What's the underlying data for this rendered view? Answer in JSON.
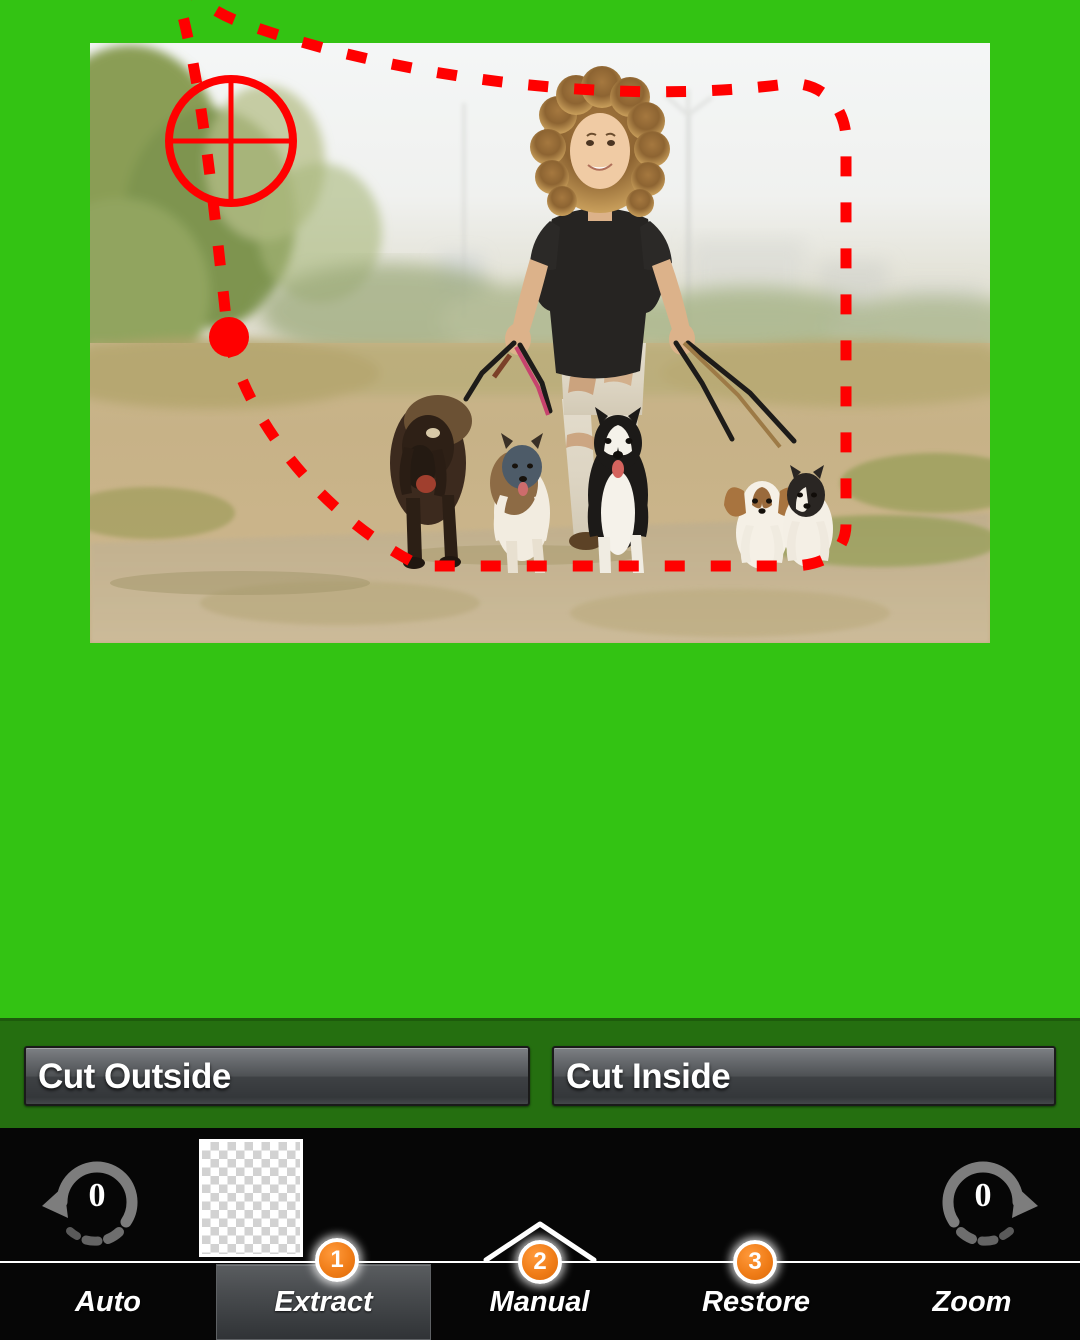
{
  "app": {
    "canvas_background_color": "#33c313",
    "cut_bar_background_color": "#256f10",
    "toolbar_background_color": "#060606",
    "accent_color": "#f07d18",
    "lasso_color": "#ff0000"
  },
  "canvas": {
    "photo_alt": "Woman walking five dogs on a dirt path",
    "selection_tool": {
      "cursor_icon": "crosshair-target-icon",
      "anchor_icon": "lasso-anchor-dot-icon",
      "path_style": "dashed",
      "path_color": "#ff0000"
    }
  },
  "cut_bar": {
    "cut_outside_label": "Cut Outside",
    "cut_inside_label": "Cut Inside"
  },
  "toolbar": {
    "undo": {
      "icon": "undo-arrow-icon",
      "count": "0"
    },
    "redo": {
      "icon": "redo-arrow-icon",
      "count": "0"
    },
    "thumbnail": {
      "icon": "transparency-checkerboard-icon"
    },
    "manual_indicator_icon": "chevron-up-icon"
  },
  "tabs": [
    {
      "label": "Auto",
      "selected": false,
      "badge": null
    },
    {
      "label": "Extract",
      "selected": true,
      "badge": "1"
    },
    {
      "label": "Manual",
      "selected": false,
      "badge": "2"
    },
    {
      "label": "Restore",
      "selected": false,
      "badge": "3"
    },
    {
      "label": "Zoom",
      "selected": false,
      "badge": null
    }
  ],
  "badges": {
    "one": "1",
    "two": "2",
    "three": "3"
  }
}
